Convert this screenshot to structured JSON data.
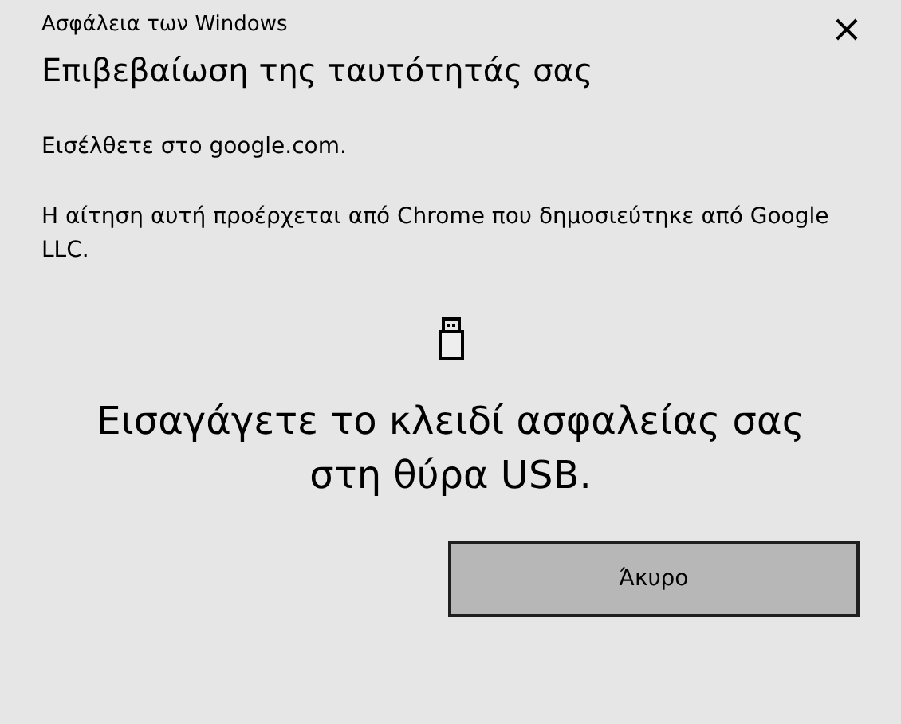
{
  "window": {
    "title": "Ασφάλεια των Windows",
    "close": "×"
  },
  "heading": "Επιβεβαίωση της ταυτότητάς σας",
  "paragraphs": [
    "Εισέλθετε στο google.com.",
    "Η αίτηση αυτή προέρχεται από Chrome που δημοσιεύτηκε από Google LLC."
  ],
  "instruction": "Εισαγάγετε το κλειδί ασφαλείας σας στη θύρα USB.",
  "buttons": [
    {
      "label": "Άκυρο",
      "focused": true
    }
  ]
}
